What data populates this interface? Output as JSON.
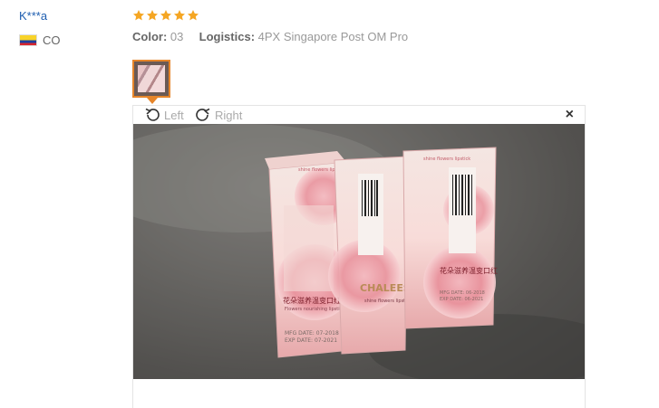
{
  "reviewer": {
    "name": "K***a",
    "country": "CO",
    "flag_colors": [
      "#f8d32a",
      "#1d3f9f",
      "#d7262f"
    ]
  },
  "review": {
    "rating": 5,
    "max_rating": 5,
    "star_color": "#f5a623",
    "color_label": "Color:",
    "color_value": "03",
    "logistics_label": "Logistics:",
    "logistics_value": "4PX Singapore Post OM Pro"
  },
  "viewer": {
    "rotate_left_label": "Left",
    "rotate_right_label": "Right",
    "close_label": "×",
    "photo_subject": "three lipstick boxes with pink rose print on grey carpet",
    "box_texts": {
      "box1_top": "shine flowers lipstick",
      "box1_cn": "花朵滋养温变口红",
      "box1_line": "Flowers nourishing lipstick",
      "box1_mfg": "MFG DATE: 07-2018",
      "box1_exp": "EXP DATE: 07-2021",
      "box2_brand": "CHALEES",
      "box2_sub": "shine flowers lipstick",
      "box3_top": "shine flowers lipstick",
      "box3_cn": "花朵滋养温变口红",
      "box3_mfg": "MFG DATE: 06-2018",
      "box3_exp": "EXP DATE: 06-2021"
    }
  }
}
